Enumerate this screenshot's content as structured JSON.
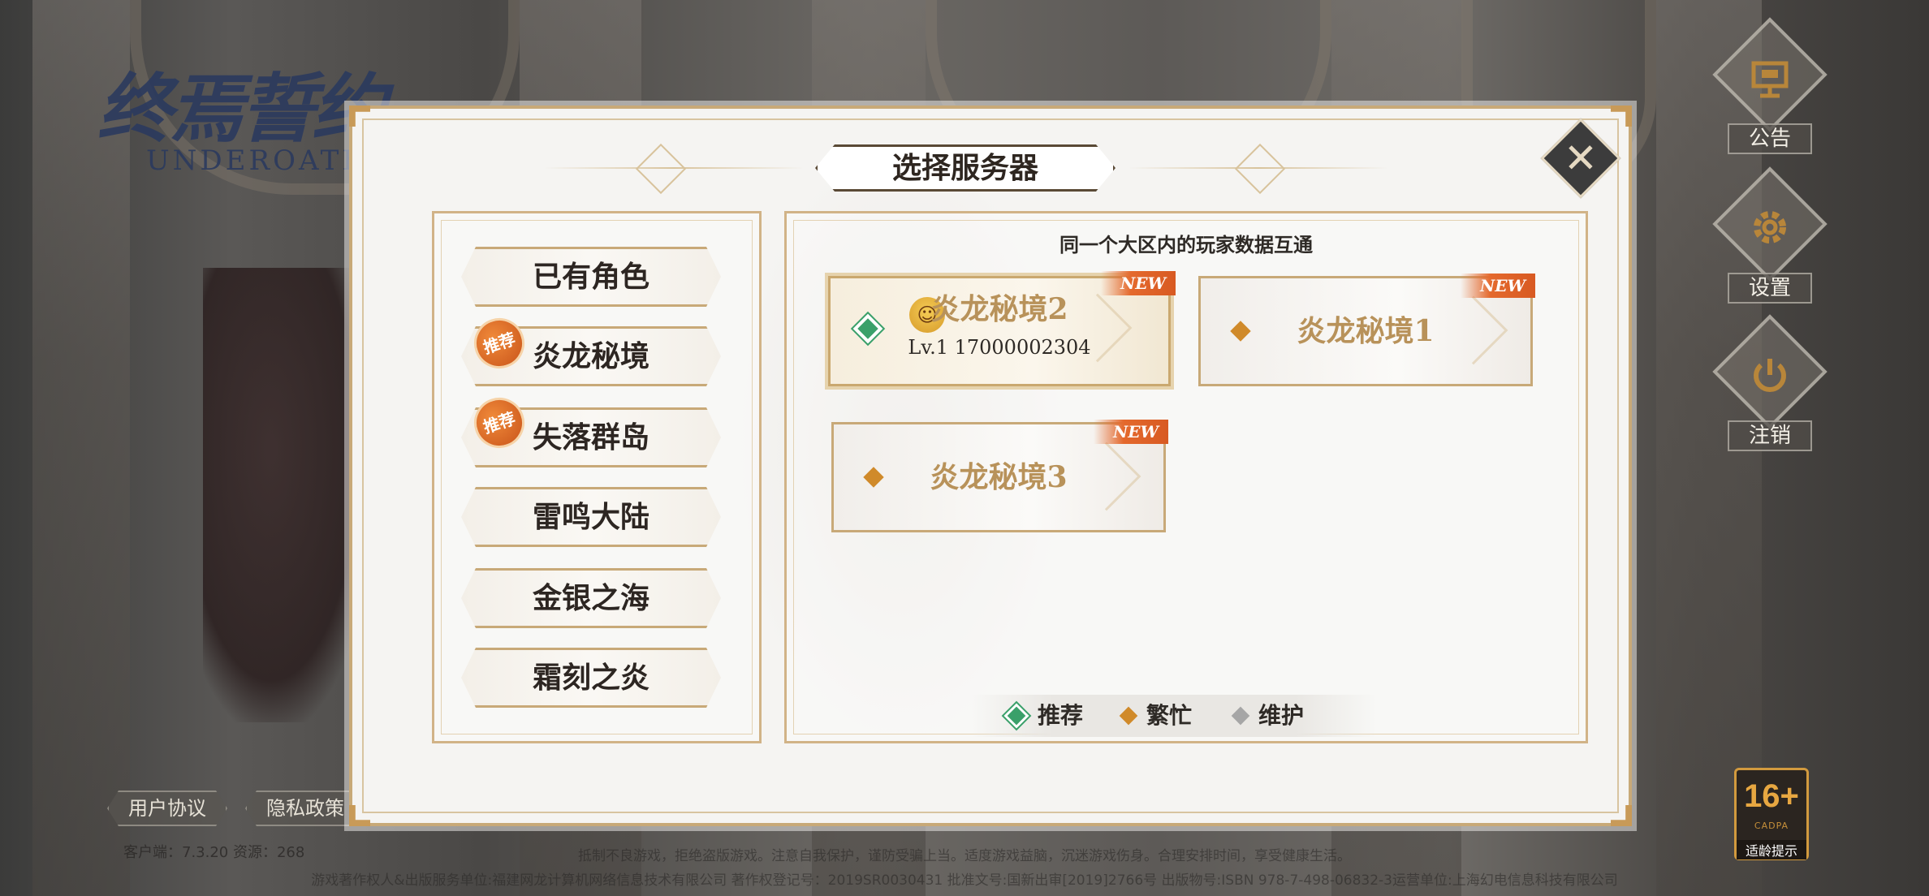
{
  "logo": {
    "cn": "终焉誓约",
    "en": "UNDEROATH"
  },
  "dialog": {
    "title": "选择服务器",
    "hint": "同一个大区内的玩家数据互通"
  },
  "regions": [
    {
      "label": "已有角色",
      "badge": ""
    },
    {
      "label": "炎龙秘境",
      "badge": "推荐"
    },
    {
      "label": "失落群岛",
      "badge": "推荐"
    },
    {
      "label": "雷鸣大陆",
      "badge": ""
    },
    {
      "label": "金银之海",
      "badge": ""
    },
    {
      "label": "霜刻之炎",
      "badge": ""
    }
  ],
  "servers": [
    {
      "name": "炎龙秘境2",
      "sub": "Lv.1 17000002304",
      "tag": "NEW",
      "status": "recommended",
      "selected": true
    },
    {
      "name": "炎龙秘境1",
      "sub": "",
      "tag": "NEW",
      "status": "busy",
      "selected": false
    },
    {
      "name": "炎龙秘境3",
      "sub": "",
      "tag": "NEW",
      "status": "busy",
      "selected": false
    }
  ],
  "legend": [
    {
      "label": "推荐",
      "color": "#3aa06a"
    },
    {
      "label": "繁忙",
      "color": "#d08a2a"
    },
    {
      "label": "维护",
      "color": "#a6a6a6"
    }
  ],
  "side_buttons": [
    {
      "label": "公告",
      "icon": "notice-board-icon"
    },
    {
      "label": "设置",
      "icon": "gear-icon"
    },
    {
      "label": "注销",
      "icon": "power-icon"
    }
  ],
  "bottom_links": {
    "user_agreement": "用户协议",
    "privacy_policy": "隐私政策"
  },
  "version_text": "客户端：7.3.20   资源：268",
  "footer": {
    "line1": "抵制不良游戏，拒绝盗版游戏。注意自我保护，谨防受骗上当。适度游戏益脑，沉迷游戏伤身。合理安排时间，享受健康生活。",
    "line2": "游戏著作权人&出版服务单位:福建网龙计算机网络信息技术有限公司  著作权登记号：2019SR0030431  批准文号:国新出审[2019]2766号  出版物号:ISBN 978-7-498-06832-3运营单位:上海幻电信息科技有限公司"
  },
  "age_rating": {
    "age": "16+",
    "org": "CADPA",
    "tip": "适龄提示"
  },
  "colors": {
    "accent_gold": "#c8a978",
    "new_tag": "#e4692d",
    "recommend_green": "#3aa06a",
    "busy_orange": "#d08a2a",
    "maintenance_gray": "#a6a6a6"
  }
}
